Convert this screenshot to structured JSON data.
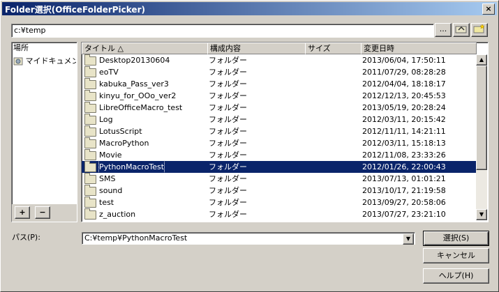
{
  "window": {
    "title": "Folder選択(OfficeFolderPicker)",
    "close_label": "×"
  },
  "toolbar": {
    "path_value": "c:¥temp",
    "btn_more": "...",
    "btn_up_icon": "up-folder-icon",
    "btn_new_icon": "new-folder-icon"
  },
  "places": {
    "header": "場所",
    "items": [
      {
        "label": "マイドキュメント"
      }
    ],
    "add_label": "+",
    "remove_label": "−"
  },
  "filelist": {
    "columns": [
      "タイトル △",
      "構成内容",
      "サイズ",
      "変更日時"
    ],
    "rows": [
      {
        "name": "Desktop20130604",
        "type": "フォルダー",
        "size": "",
        "date": "2013/06/04, 17:50:11"
      },
      {
        "name": "eoTV",
        "type": "フォルダー",
        "size": "",
        "date": "2011/07/29, 08:28:28"
      },
      {
        "name": "kabuka_Pass_ver3",
        "type": "フォルダー",
        "size": "",
        "date": "2012/04/04, 18:18:17"
      },
      {
        "name": "kinyu_for_OOo_ver2",
        "type": "フォルダー",
        "size": "",
        "date": "2012/12/13, 20:45:53"
      },
      {
        "name": "LibreOfficeMacro_test",
        "type": "フォルダー",
        "size": "",
        "date": "2013/05/19, 20:28:24"
      },
      {
        "name": "Log",
        "type": "フォルダー",
        "size": "",
        "date": "2012/03/11, 20:15:42"
      },
      {
        "name": "LotusScript",
        "type": "フォルダー",
        "size": "",
        "date": "2012/11/11, 14:21:11"
      },
      {
        "name": "MacroPython",
        "type": "フォルダー",
        "size": "",
        "date": "2012/03/11, 15:18:13"
      },
      {
        "name": "Movie",
        "type": "フォルダー",
        "size": "",
        "date": "2012/11/08, 23:33:26"
      },
      {
        "name": "PythonMacroTest",
        "type": "フォルダー",
        "size": "",
        "date": "2012/01/26, 22:00:43",
        "selected": true
      },
      {
        "name": "SMS",
        "type": "フォルダー",
        "size": "",
        "date": "2013/07/13, 01:01:21"
      },
      {
        "name": "sound",
        "type": "フォルダー",
        "size": "",
        "date": "2013/10/17, 21:19:58"
      },
      {
        "name": "test",
        "type": "フォルダー",
        "size": "",
        "date": "2013/09/27, 20:58:06"
      },
      {
        "name": "z_auction",
        "type": "フォルダー",
        "size": "",
        "date": "2013/07/27, 23:21:10"
      }
    ],
    "scroll_up": "▲",
    "scroll_down": "▼"
  },
  "path_row": {
    "label": "パス(P):",
    "value": "C:¥temp¥PythonMacroTest",
    "dropdown": "▼"
  },
  "buttons": {
    "select": "選択(S)",
    "cancel": "キャンセル",
    "help": "ヘルプ(H)"
  },
  "colors": {
    "titlebar": "#0a246a",
    "selection": "#0a246a",
    "face": "#d4d0c8"
  }
}
